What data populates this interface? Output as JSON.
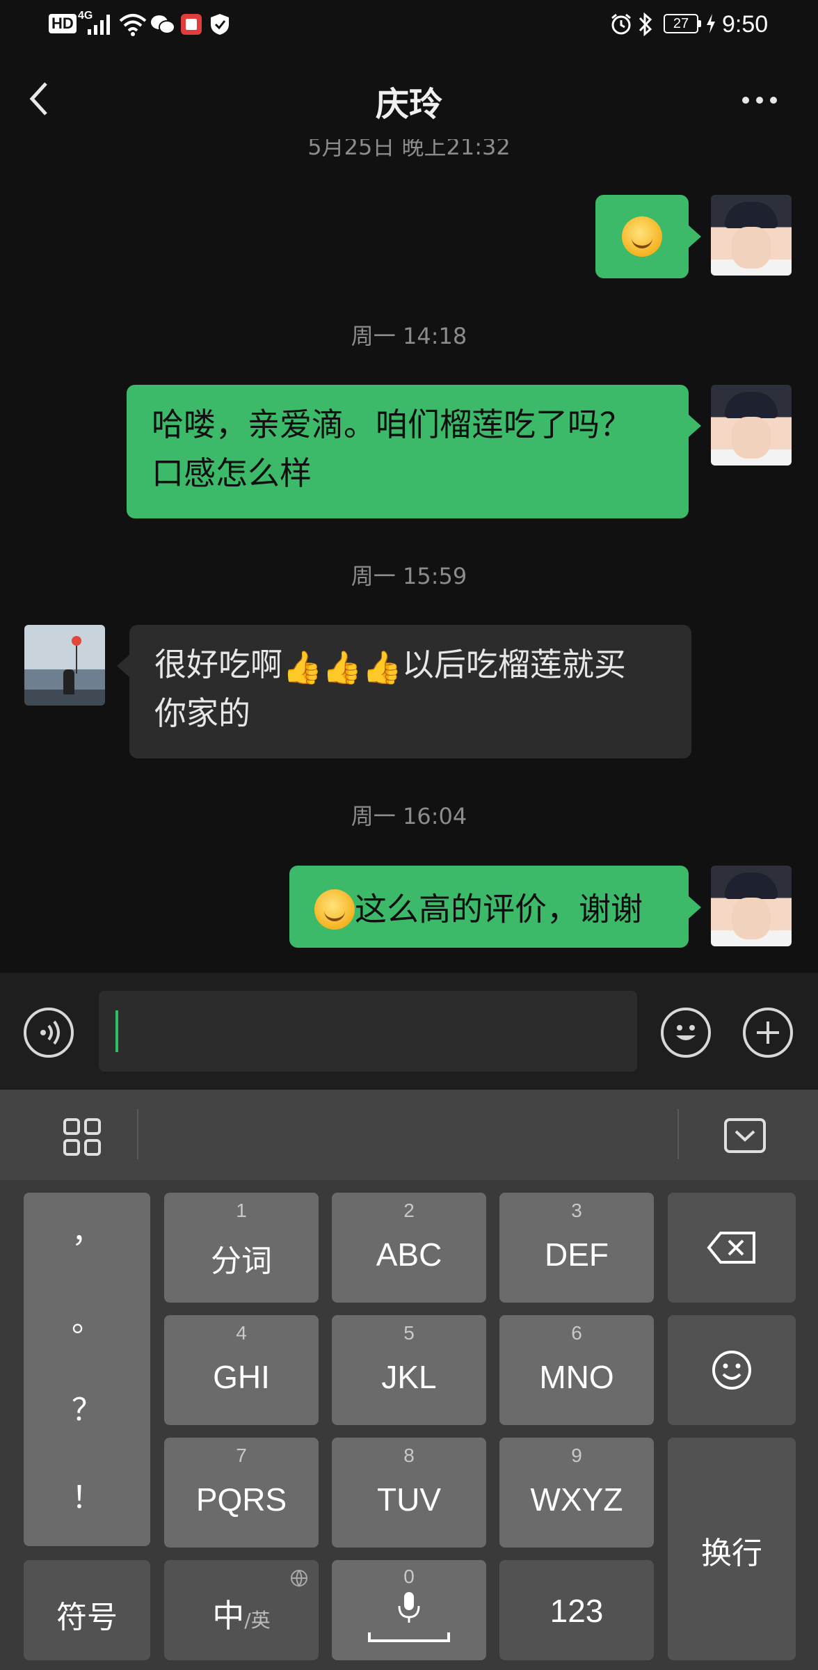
{
  "status_bar": {
    "left_icons": [
      "hd-icon",
      "signal-4g-icon",
      "wifi-icon",
      "wechat-icon",
      "book-app-icon",
      "shield-icon"
    ],
    "hd": "HD",
    "network": "4G",
    "battery": "27",
    "time": "9:50"
  },
  "header": {
    "title": "庆玲",
    "partial_timestamp": "5月25日 晚上21:32"
  },
  "messages": [
    {
      "side": "me",
      "text": ""
    },
    {
      "timestamp": "周一 14:18"
    },
    {
      "side": "me",
      "line1": "哈喽，亲爱滴。咱们榴莲吃了吗？",
      "line2": "口感怎么样"
    },
    {
      "timestamp": "周一 15:59"
    },
    {
      "side": "them",
      "line1_a": "很好吃啊",
      "line1_b": "以后吃榴莲就买",
      "line2": "你家的"
    },
    {
      "timestamp": "周一 16:04"
    },
    {
      "side": "me",
      "text": "这么高的评价，谢谢"
    }
  ],
  "keyboard": {
    "punct": [
      "，",
      "。",
      "？",
      "！"
    ],
    "keys": [
      {
        "num": "1",
        "label": "分词"
      },
      {
        "num": "2",
        "label": "ABC"
      },
      {
        "num": "3",
        "label": "DEF"
      },
      {
        "num": "4",
        "label": "GHI"
      },
      {
        "num": "5",
        "label": "JKL"
      },
      {
        "num": "6",
        "label": "MNO"
      },
      {
        "num": "7",
        "label": "PQRS"
      },
      {
        "num": "8",
        "label": "TUV"
      },
      {
        "num": "9",
        "label": "WXYZ"
      }
    ],
    "enter": "换行",
    "symbols": "符号",
    "lang_main": "中",
    "lang_sub": "/英",
    "space_num": "0",
    "numbers": "123"
  },
  "colors": {
    "my_bubble": "#3cba6a",
    "their_bubble": "#2c2c2c",
    "background": "#111111"
  }
}
